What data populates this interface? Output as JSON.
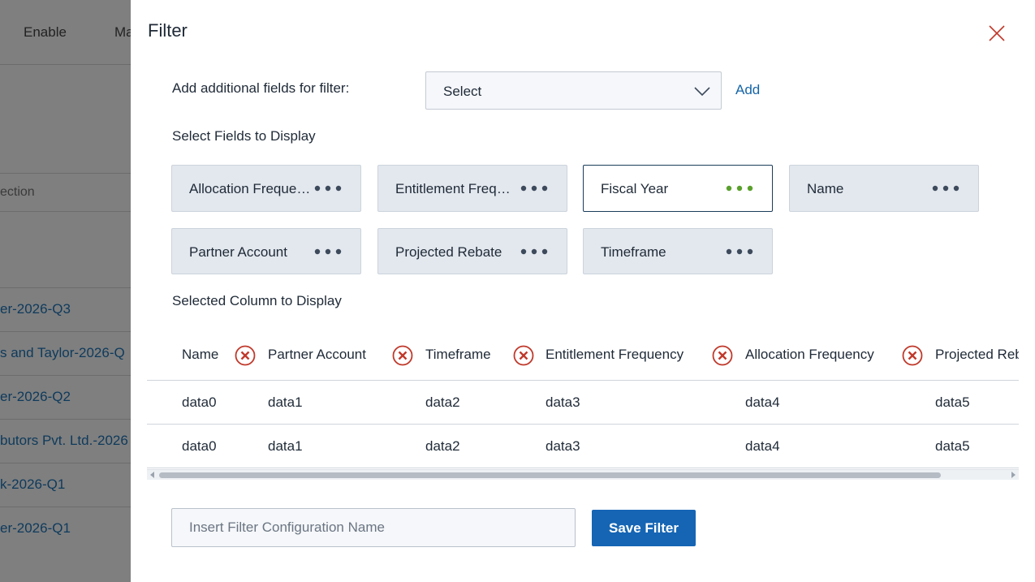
{
  "background": {
    "toolbar": {
      "enable_label": "Enable",
      "partial_label": "Ma"
    },
    "filter_placeholder_fragment": "ection",
    "rows": [
      "er-2026-Q3",
      "s and Taylor-2026-Q",
      "er-2026-Q2",
      "butors Pvt. Ltd.-2026",
      "k-2026-Q1",
      "er-2026-Q1"
    ]
  },
  "drawer": {
    "title": "Filter",
    "add_fields_label": "Add additional fields for filter:",
    "select_value": "Select",
    "add_label": "Add",
    "fields_label": "Select Fields to Display",
    "fields": [
      {
        "label": "Allocation Frequency",
        "active": false
      },
      {
        "label": "Entitlement Frequency",
        "active": false
      },
      {
        "label": "Fiscal Year",
        "active": true
      },
      {
        "label": "Name",
        "active": false
      },
      {
        "label": "Partner Account",
        "active": false
      },
      {
        "label": "Projected Rebate",
        "active": false
      },
      {
        "label": "Timeframe",
        "active": false
      }
    ],
    "selected_label": "Selected Column to Display",
    "table": {
      "columns": [
        "Name",
        "Partner Account",
        "Timeframe",
        "Entitlement Frequency",
        "Allocation Frequency",
        "Projected Rebate"
      ],
      "rows": [
        [
          "data0",
          "data1",
          "data2",
          "data3",
          "data4",
          "data5"
        ],
        [
          "data0",
          "data1",
          "data2",
          "data3",
          "data4",
          "data5"
        ]
      ]
    },
    "config_placeholder": "Insert Filter Configuration Name",
    "save_label": "Save Filter"
  },
  "colors": {
    "accent": "#1565b4",
    "link": "#1565a8",
    "remove_icon": "#c0392b",
    "active_dots": "#5aa02c",
    "dots": "#3d4a5c",
    "overlay": "#7f7f7f"
  }
}
